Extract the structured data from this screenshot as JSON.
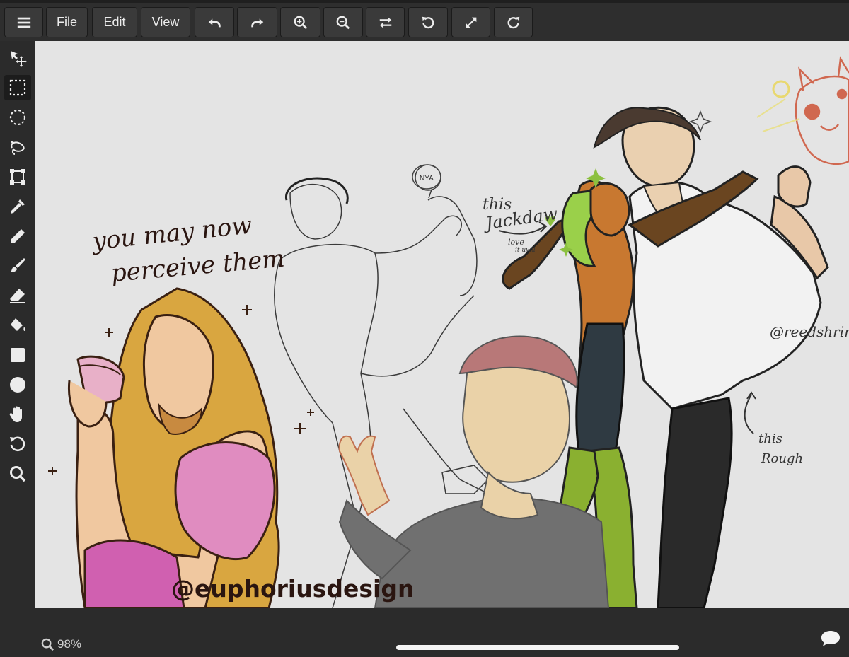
{
  "toolbar": {
    "menu_icon": "hamburger-icon",
    "file_label": "File",
    "edit_label": "Edit",
    "view_label": "View",
    "icons": [
      "undo-icon",
      "redo-icon",
      "zoom-in-icon",
      "zoom-out-icon",
      "swap-icon",
      "rotate-left-icon",
      "fullscreen-icon",
      "rotate-right-icon"
    ]
  },
  "tools": [
    {
      "name": "move-tool",
      "icon": "move-icon",
      "active": false
    },
    {
      "name": "rect-select-tool",
      "icon": "rect-select-icon",
      "active": true
    },
    {
      "name": "ellipse-select-tool",
      "icon": "ellipse-select-icon",
      "active": false
    },
    {
      "name": "lasso-tool",
      "icon": "lasso-icon",
      "active": false
    },
    {
      "name": "transform-tool",
      "icon": "transform-icon",
      "active": false
    },
    {
      "name": "eyedropper-tool",
      "icon": "eyedropper-icon",
      "active": false
    },
    {
      "name": "pencil-tool",
      "icon": "pencil-icon",
      "active": false
    },
    {
      "name": "brush-tool",
      "icon": "brush-icon",
      "active": false
    },
    {
      "name": "eraser-tool",
      "icon": "eraser-icon",
      "active": false
    },
    {
      "name": "fill-tool",
      "icon": "paint-bucket-icon",
      "active": false
    },
    {
      "name": "rectangle-tool",
      "icon": "square-icon",
      "active": false
    },
    {
      "name": "ellipse-tool",
      "icon": "circle-icon",
      "active": false
    },
    {
      "name": "hand-tool",
      "icon": "hand-icon",
      "active": false
    },
    {
      "name": "rotate-view-tool",
      "icon": "rotate-icon",
      "active": false
    },
    {
      "name": "zoom-tool",
      "icon": "magnifier-icon",
      "active": false
    }
  ],
  "canvas": {
    "text_you_may": "you may now",
    "text_perceive": "perceive them",
    "text_nya": "NYA",
    "text_this1": "this",
    "text_jackdaw": "Jackdaw",
    "text_love": "love",
    "text_it_uwu": "it uwu",
    "text_reedshrine": "@reedshrine",
    "text_this2": "this",
    "text_rough": "Rough",
    "text_euphorius": "@euphoriusdesign"
  },
  "status": {
    "zoom_icon": "search-icon",
    "zoom_text": "98%",
    "chat_icon": "chat-bubble-icon"
  },
  "colors": {
    "toolbar_bg": "#2e2e2e",
    "button_bg": "#3a3a3a",
    "canvas_bg": "#e4e4e4",
    "icon_color": "#ececec"
  }
}
